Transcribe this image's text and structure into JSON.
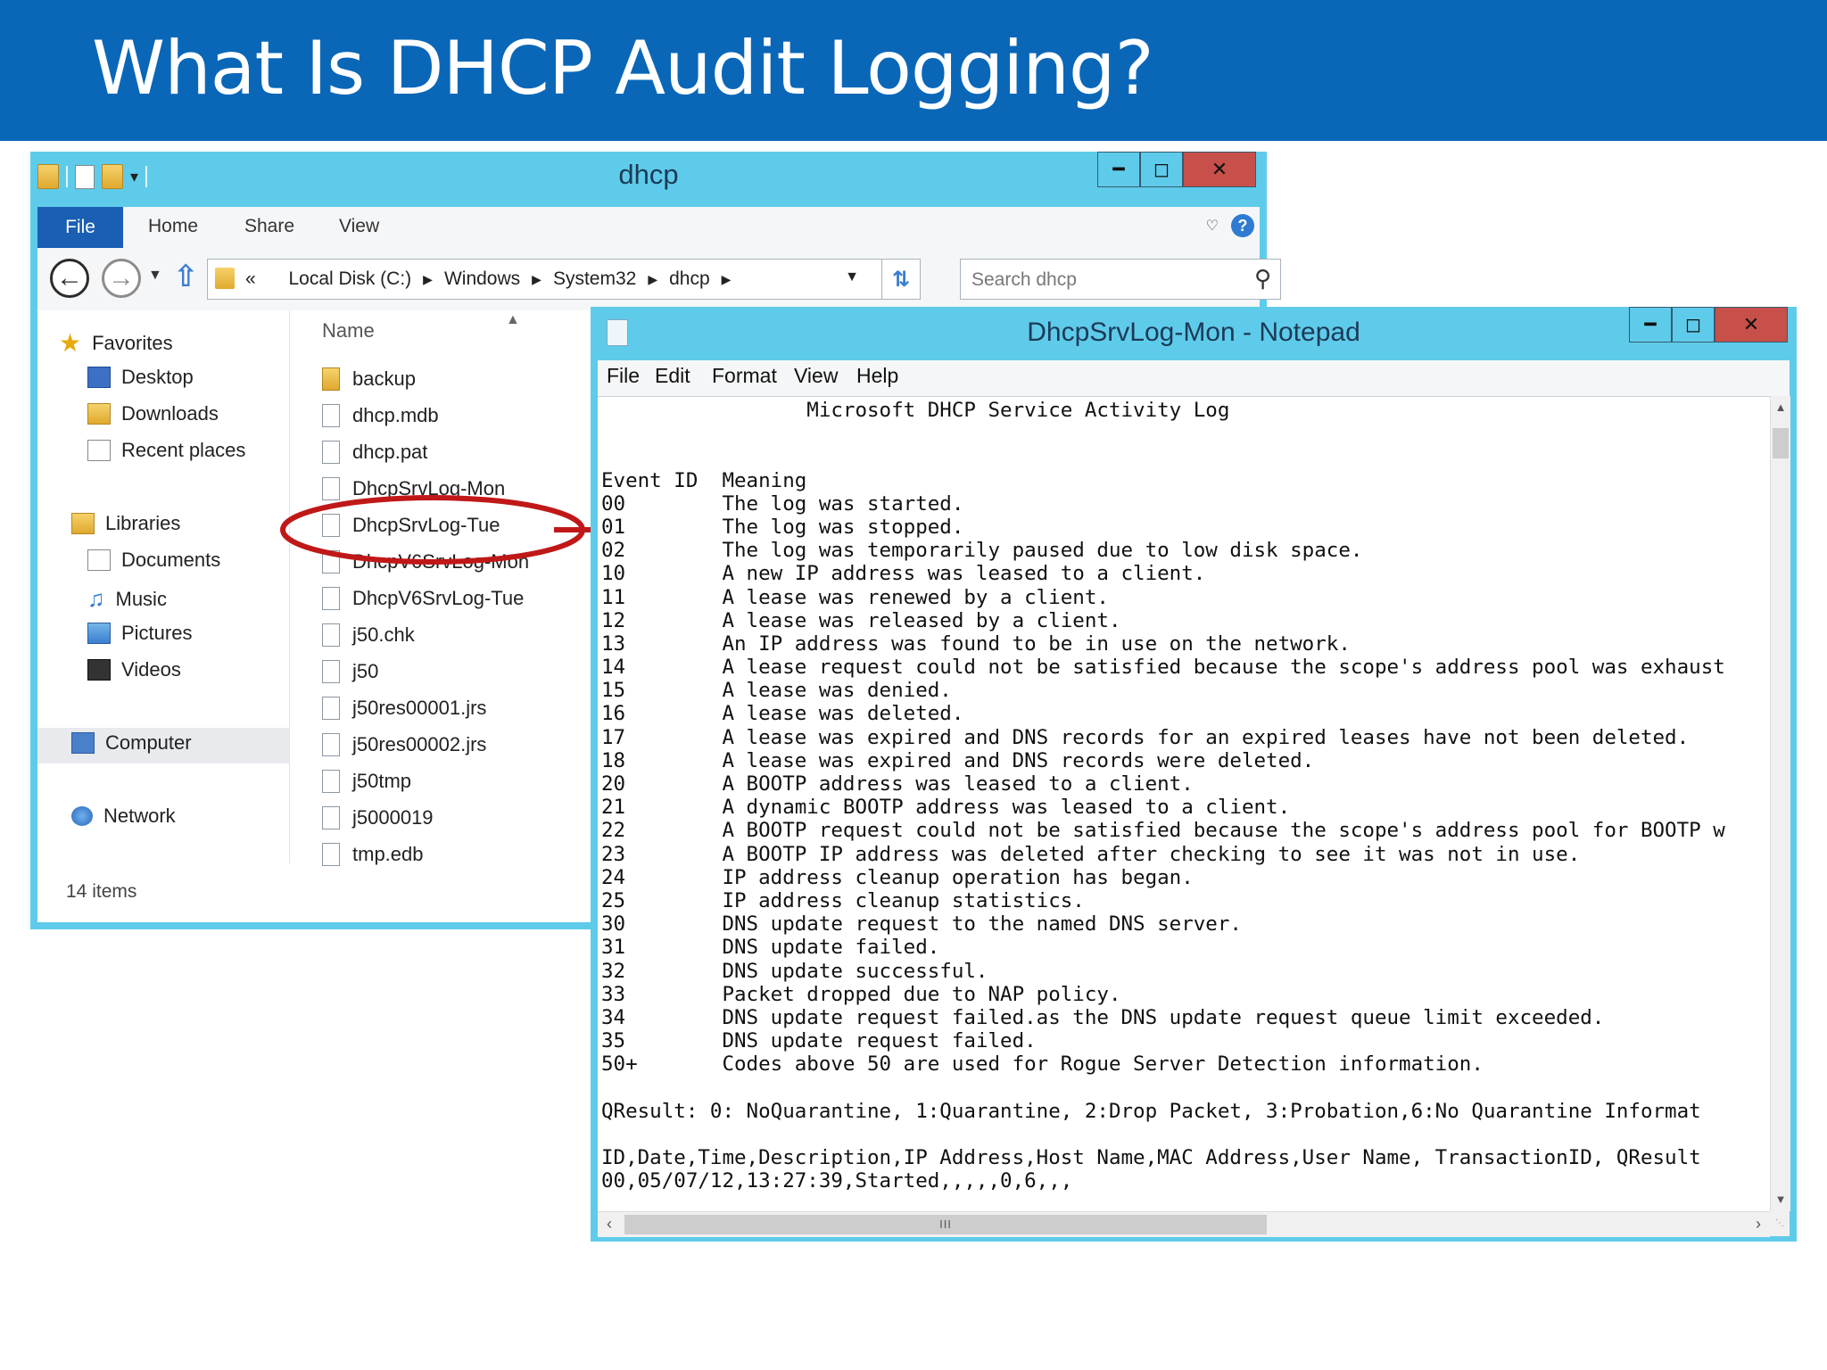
{
  "slide": {
    "title": "What Is DHCP Audit Logging?"
  },
  "explorer": {
    "title": "dhcp",
    "ribbon": {
      "file": "File",
      "tabs": [
        "Home",
        "Share",
        "View"
      ]
    },
    "address": {
      "prefix": "«",
      "crumbs": [
        "Local Disk (C:)",
        "Windows",
        "System32",
        "dhcp"
      ]
    },
    "search_placeholder": "Search dhcp",
    "nav": {
      "favorites": "Favorites",
      "desktop": "Desktop",
      "downloads": "Downloads",
      "recent": "Recent places",
      "libraries": "Libraries",
      "documents": "Documents",
      "music": "Music",
      "pictures": "Pictures",
      "videos": "Videos",
      "computer": "Computer",
      "network": "Network"
    },
    "column_name": "Name",
    "files": [
      "backup",
      "dhcp.mdb",
      "dhcp.pat",
      "DhcpSrvLog-Mon",
      "DhcpSrvLog-Tue",
      "DhcpV6SrvLog-Mon",
      "DhcpV6SrvLog-Tue",
      "j50.chk",
      "j50",
      "j50res00001.jrs",
      "j50res00002.jrs",
      "j50tmp",
      "j5000019",
      "tmp.edb"
    ],
    "status": "14 items"
  },
  "notepad": {
    "title": "DhcpSrvLog-Mon - Notepad",
    "menu": [
      "File",
      "Edit",
      "Format",
      "View",
      "Help"
    ],
    "lines": [
      "                 Microsoft DHCP Service Activity Log",
      "",
      "",
      "Event ID  Meaning",
      "00        The log was started.",
      "01        The log was stopped.",
      "02        The log was temporarily paused due to low disk space.",
      "10        A new IP address was leased to a client.",
      "11        A lease was renewed by a client.",
      "12        A lease was released by a client.",
      "13        An IP address was found to be in use on the network.",
      "14        A lease request could not be satisfied because the scope's address pool was exhaust",
      "15        A lease was denied.",
      "16        A lease was deleted.",
      "17        A lease was expired and DNS records for an expired leases have not been deleted.",
      "18        A lease was expired and DNS records were deleted.",
      "20        A BOOTP address was leased to a client.",
      "21        A dynamic BOOTP address was leased to a client.",
      "22        A BOOTP request could not be satisfied because the scope's address pool for BOOTP w",
      "23        A BOOTP IP address was deleted after checking to see it was not in use.",
      "24        IP address cleanup operation has began.",
      "25        IP address cleanup statistics.",
      "30        DNS update request to the named DNS server.",
      "31        DNS update failed.",
      "32        DNS update successful.",
      "33        Packet dropped due to NAP policy.",
      "34        DNS update request failed.as the DNS update request queue limit exceeded.",
      "35        DNS update request failed.",
      "50+       Codes above 50 are used for Rogue Server Detection information.",
      "",
      "QResult: 0: NoQuarantine, 1:Quarantine, 2:Drop Packet, 3:Probation,6:No Quarantine Informat",
      "",
      "ID,Date,Time,Description,IP Address,Host Name,MAC Address,User Name, TransactionID, QResult",
      "00,05/07/12,13:27:39,Started,,,,,0,6,,,"
    ]
  }
}
